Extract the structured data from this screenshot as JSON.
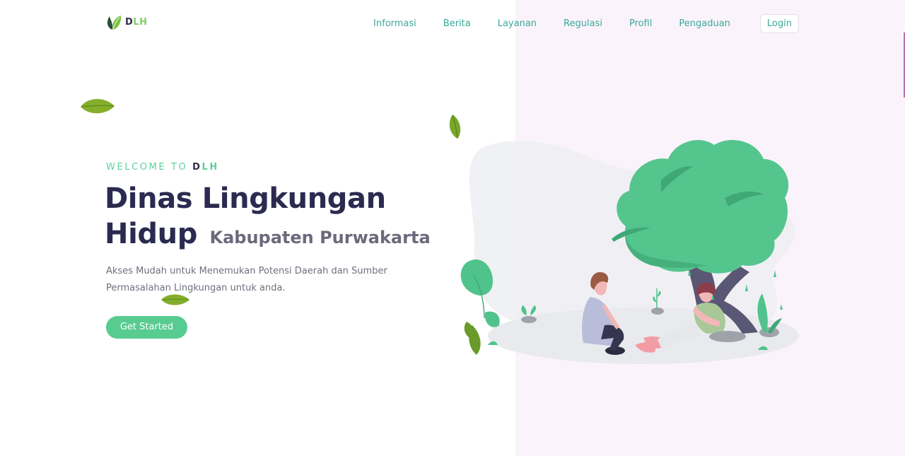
{
  "navbar": {
    "brand": {
      "d": "D",
      "lh": "LH"
    },
    "menu": [
      {
        "label": "Informasi"
      },
      {
        "label": "Berita"
      },
      {
        "label": "Layanan"
      },
      {
        "label": "Regulasi"
      },
      {
        "label": "Profil"
      },
      {
        "label": "Pengaduan"
      }
    ],
    "login_label": "Login"
  },
  "hero": {
    "welcome_prefix": "WELCOME TO ",
    "welcome_brand_d": "D",
    "welcome_brand_lh": "LH",
    "title_main": "Dinas Lingkungan Hidup",
    "title_sub": "Kabupaten Purwakarta",
    "description": "Akses Mudah untuk Menemukan Potensi Daerah dan Sumber Permasalahan Lingkungan untuk anda.",
    "cta_label": "Get Started"
  },
  "colors": {
    "brand_green": "#58cb91",
    "nav_teal": "#3aa89b",
    "title_navy": "#2b2a50",
    "panel_pink": "#fbf3fb",
    "leaf_green": "#7cc243"
  },
  "icons": {
    "logo": "leaf-logo-icon",
    "decor": "leaf-icon"
  }
}
